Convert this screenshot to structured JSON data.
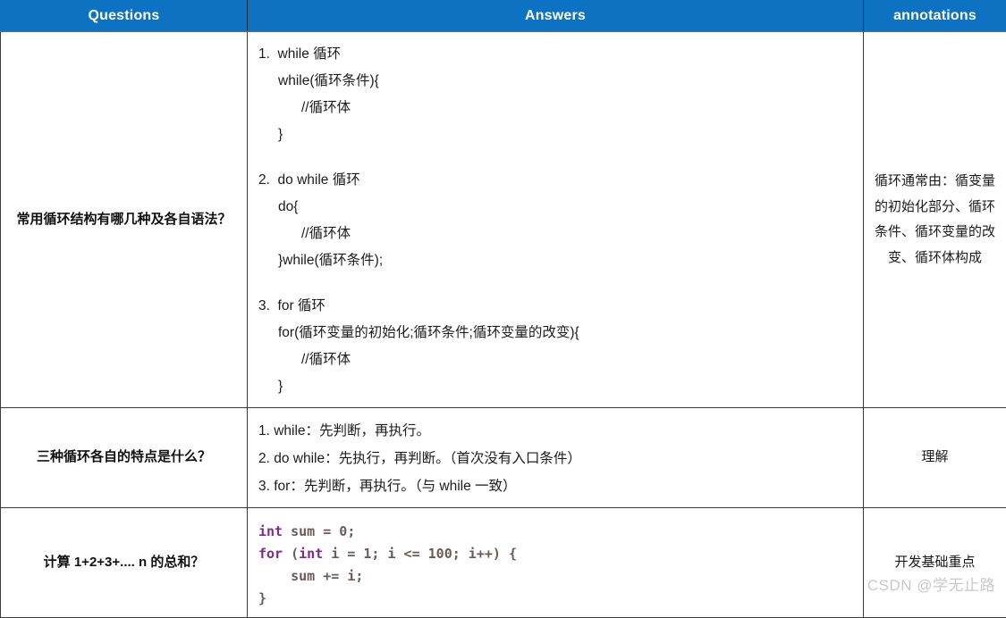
{
  "table": {
    "headers": {
      "questions": "Questions",
      "answers": "Answers",
      "annotations": "annotations"
    },
    "header_bg": "#0E72C2",
    "header_fg": "#FFFFFF",
    "border_color": "#3B3B3B",
    "rows": [
      {
        "question": "常用循环结构有哪几种及各自语法？",
        "answer_blocks": [
          {
            "lines": [
              "1.  while 循环",
              "while(循环条件){",
              "//循环体",
              "}"
            ]
          },
          {
            "lines": [
              "2.  do while 循环",
              "do{",
              "//循环体",
              "}while(循环条件);"
            ]
          },
          {
            "lines": [
              "3.  for 循环",
              "for(循环变量的初始化;循环条件;循环变量的改变){",
              "//循环体",
              "}"
            ]
          }
        ],
        "annotation": "循环通常由：循变量的初始化部分、循环条件、循环变量的改变、循环体构成"
      },
      {
        "question": "三种循环各自的特点是什么？",
        "answer_lines": [
          "1. while：先判断，再执行。",
          "2. do while：先执行，再判断。（首次没有入口条件）",
          "3. for：先判断，再执行。（与 while 一致）"
        ],
        "annotation": "理解"
      },
      {
        "question": "计算 1+2+3+.... n 的总和？",
        "code": {
          "language": "java",
          "keyword_color": "#7D2A8C",
          "identifier_color": "#6B5A55",
          "lines": [
            [
              {
                "t": "int",
                "c": "kw"
              },
              {
                "t": " sum = 0;",
                "c": "id"
              }
            ],
            [
              {
                "t": "for",
                "c": "kw"
              },
              {
                "t": " (",
                "c": "id"
              },
              {
                "t": "int",
                "c": "kw"
              },
              {
                "t": " i = 1; i <= 100; i++) {",
                "c": "id"
              }
            ],
            [
              {
                "t": "    sum += i;",
                "c": "id"
              }
            ],
            [
              {
                "t": "}",
                "c": "id"
              }
            ]
          ]
        },
        "annotation": "开发基础重点"
      }
    ]
  },
  "watermark": {
    "text": "CSDN @学无止路"
  }
}
